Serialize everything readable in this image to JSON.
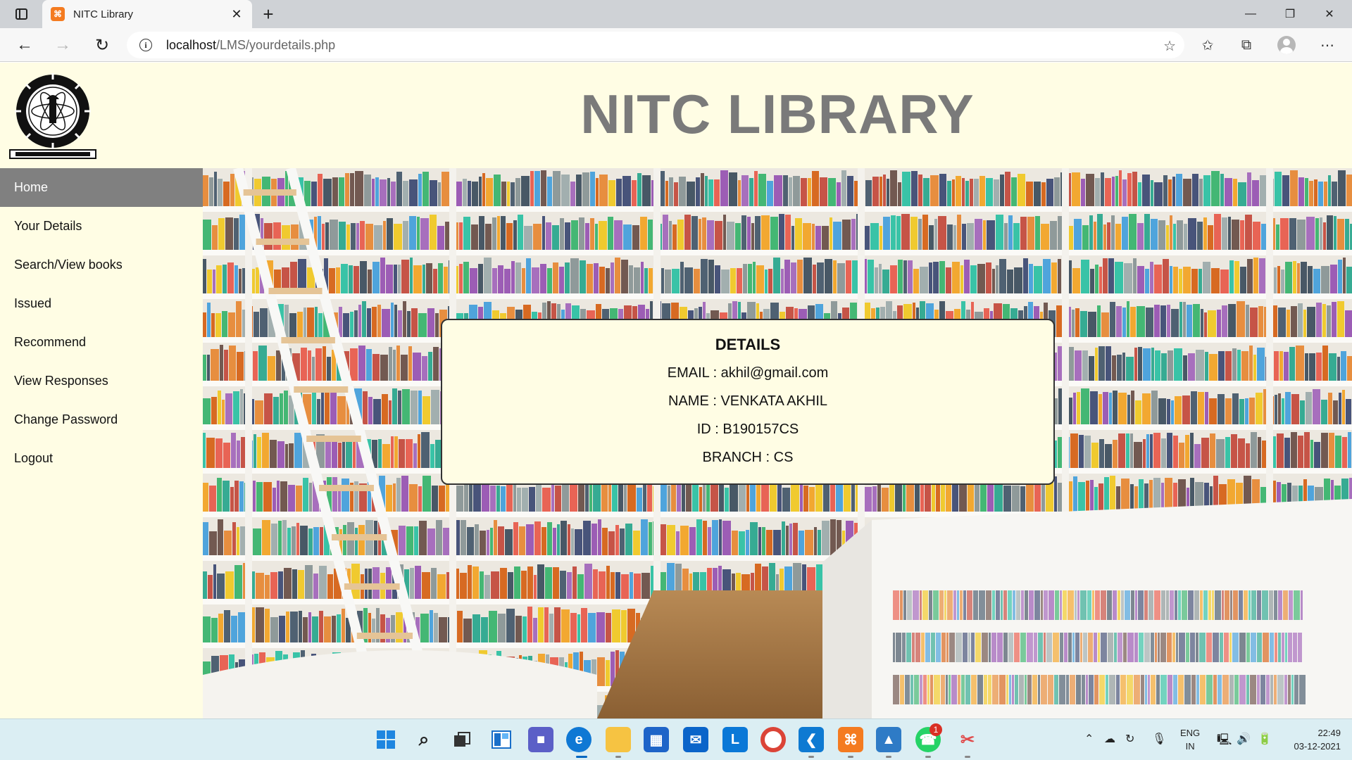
{
  "browser": {
    "tab_title": "NITC Library",
    "url_host": "localhost",
    "url_path": "/LMS/yourdetails.php"
  },
  "header": {
    "title": "NITC LIBRARY",
    "logo_alt": "National Institute of Technology Calicut"
  },
  "sidebar": {
    "items": [
      {
        "label": "Home",
        "active": true
      },
      {
        "label": "Your Details"
      },
      {
        "label": "Search/View books"
      },
      {
        "label": "Issued"
      },
      {
        "label": "Recommend"
      },
      {
        "label": "View Responses"
      },
      {
        "label": "Change Password"
      },
      {
        "label": "Logout"
      }
    ]
  },
  "details": {
    "heading": "DETAILS",
    "email": "EMAIL : akhil@gmail.com",
    "name": "NAME : VENKATA AKHIL",
    "id": "ID : B190157CS",
    "branch": "BRANCH : CS"
  },
  "taskbar": {
    "lang_line1": "ENG",
    "lang_line2": "IN",
    "time": "22:49",
    "date": "03-12-2021",
    "whatsapp_badge": "1"
  },
  "colors": {
    "page_bg": "#fffde4",
    "active_nav": "#808080",
    "title": "#7a7a7a"
  }
}
